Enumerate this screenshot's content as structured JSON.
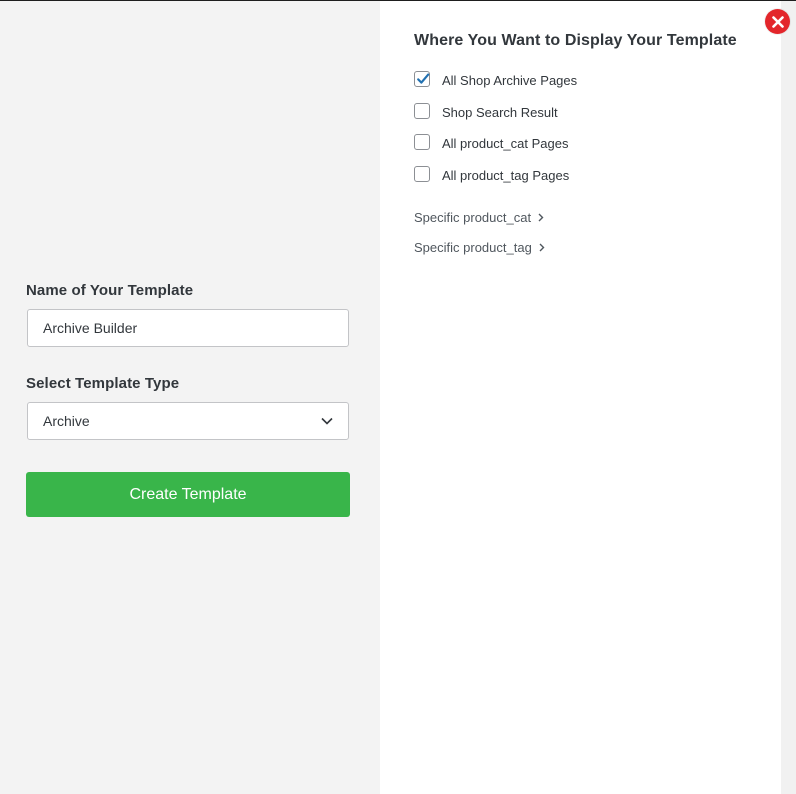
{
  "form": {
    "name_label": "Name of Your Template",
    "name_value": "Archive Builder",
    "type_label": "Select Template Type",
    "type_selected": "Archive",
    "create_button": "Create Template",
    "button_color": "#39b54a"
  },
  "display": {
    "title": "Where You Want to Display Your Template",
    "options": [
      {
        "label": "All Shop Archive Pages",
        "checked": true
      },
      {
        "label": "Shop Search Result",
        "checked": false
      },
      {
        "label": "All product_cat Pages",
        "checked": false
      },
      {
        "label": "All product_tag Pages",
        "checked": false
      }
    ],
    "specific": [
      {
        "label": "Specific product_cat"
      },
      {
        "label": "Specific product_tag"
      }
    ]
  },
  "close": {
    "icon": "close-icon",
    "color": "#e3262b"
  },
  "accent_check_color": "#2271b1"
}
